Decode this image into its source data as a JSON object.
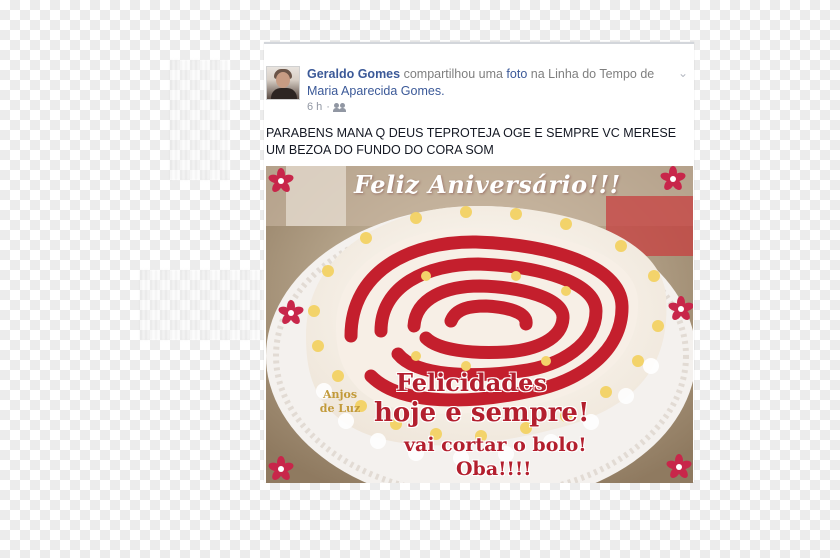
{
  "post": {
    "author": "Geraldo Gomes",
    "action_prefix": "compartilhou uma",
    "object": "foto",
    "action_mid": "na Linha do Tempo de",
    "target": "Maria Aparecida Gomes.",
    "time": "6 h",
    "audience_icon": "friends-icon",
    "menu_icon": "chevron-down-icon",
    "message": "PARABENS MANA Q DEUS TEPROTEJA OGE E SEMPRE VC MERESE UM BEZOA DO FUNDO DO CORA SOM"
  },
  "photo": {
    "title": "Feliz Aniversário!!!",
    "line1": "Felicidades",
    "line2": "hoje e sempre!",
    "line3": "vai cortar o bolo!",
    "line4": "Oba!!!!",
    "signature": "Anjos de Luz",
    "accent_color": "#b31f2e"
  }
}
